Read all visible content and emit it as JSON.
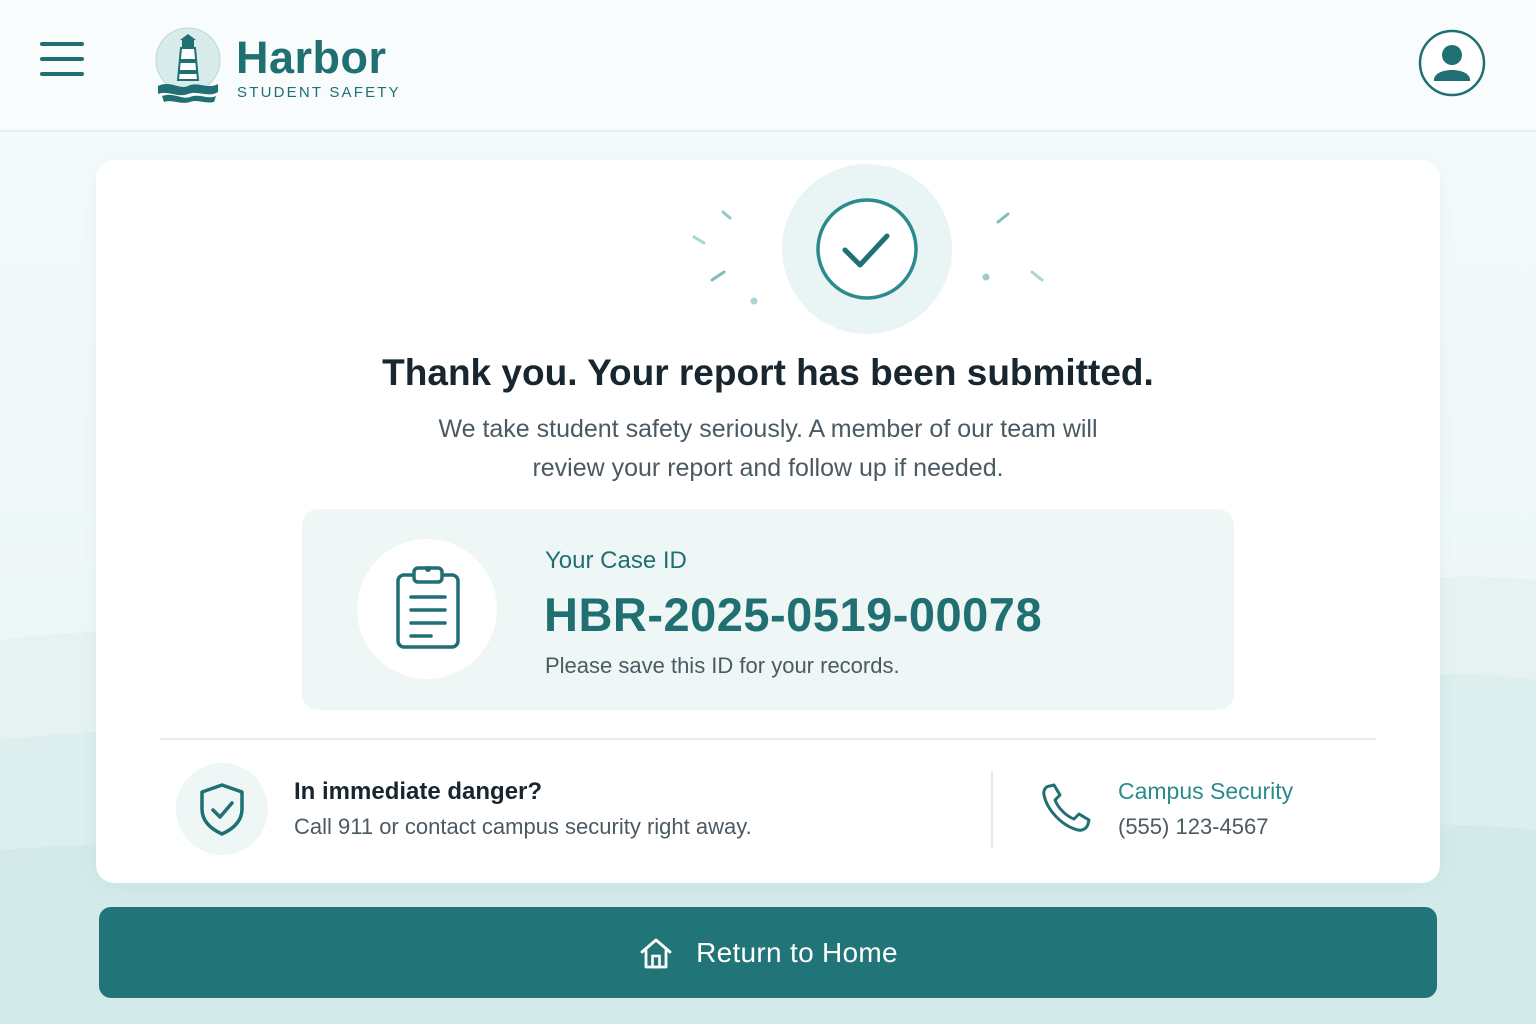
{
  "header": {
    "brand_name": "Harbor",
    "brand_subtitle": "STUDENT SAFETY"
  },
  "confirmation": {
    "title": "Thank you. Your report has been submitted.",
    "message": "We take student safety seriously. A member of our team will review your report and follow up if needed."
  },
  "case": {
    "label": "Your Case ID",
    "id": "HBR-2025-0519-00078",
    "note": "Please save this ID for your records."
  },
  "emergency": {
    "title": "In immediate danger?",
    "text": "Call 911 or contact campus security right away."
  },
  "security": {
    "label": "Campus Security",
    "phone": "(555) 123-4567"
  },
  "actions": {
    "home_label": "Return to Home"
  },
  "icons": {
    "menu": "menu-icon",
    "logo": "lighthouse-logo",
    "profile": "user-icon",
    "success": "checkmark-icon",
    "case": "clipboard-icon",
    "emergency": "shield-check-icon",
    "phone": "phone-icon",
    "home": "home-icon"
  },
  "colors": {
    "primary": "#1f6f73",
    "button": "#217478",
    "accent_light": "#eef6f6",
    "text_dark": "#17262f",
    "text_muted": "#4b5a62"
  }
}
